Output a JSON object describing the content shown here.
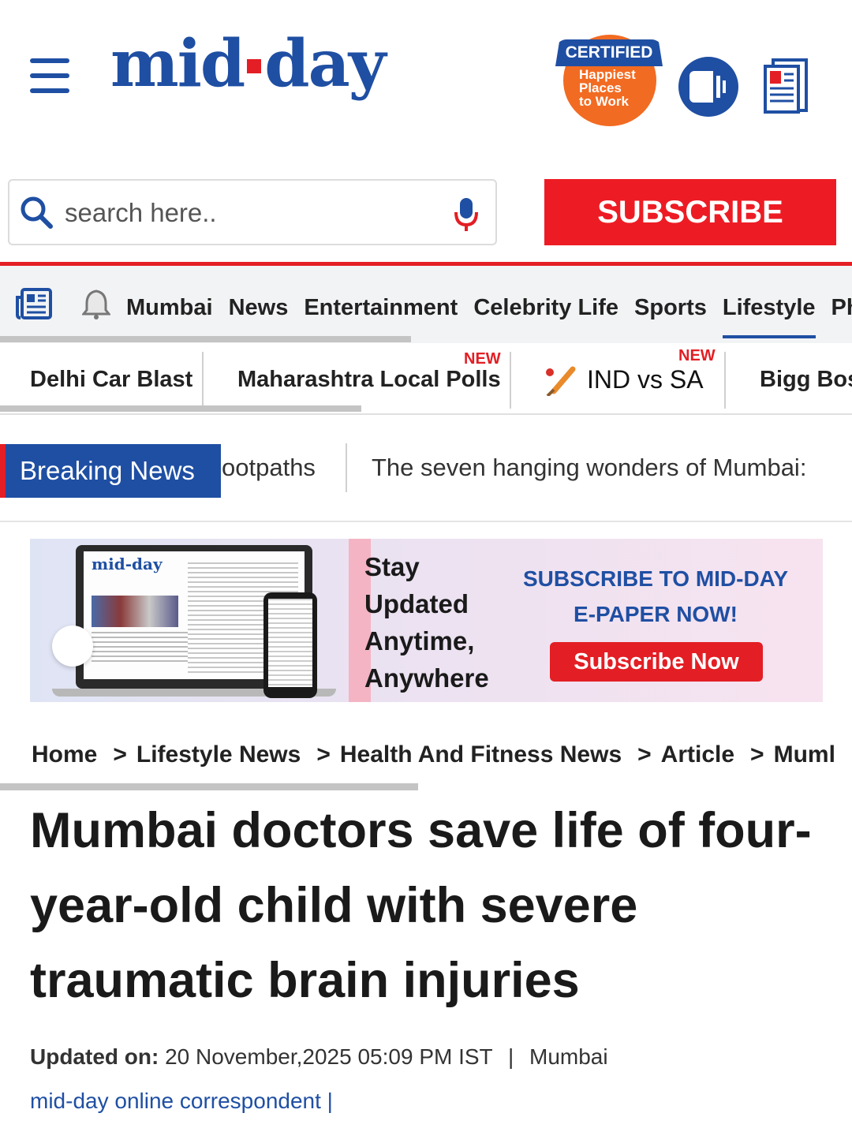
{
  "header": {
    "logo_text_left": "mid",
    "logo_text_right": "day",
    "badge": {
      "ribbon": "CERTIFIED",
      "line1": "Happiest",
      "line2": "Places",
      "line3": "to Work"
    },
    "icons": [
      "hamburger-icon",
      "audio-icon",
      "epaper-icon"
    ]
  },
  "search": {
    "placeholder": "search here..",
    "value": ""
  },
  "subscribe_label": "SUBSCRIBE",
  "main_nav": {
    "items": [
      {
        "label": "Mumbai"
      },
      {
        "label": "News"
      },
      {
        "label": "Entertainment"
      },
      {
        "label": "Celebrity Life"
      },
      {
        "label": "Sports"
      },
      {
        "label": "Lifestyle",
        "active": true
      },
      {
        "label": "Pho"
      }
    ]
  },
  "trending": {
    "items": [
      {
        "label": "Delhi Car Blast"
      },
      {
        "label": "Maharashtra Local Polls",
        "tag": "NEW"
      },
      {
        "label": "IND vs SA",
        "tag": "NEW"
      },
      {
        "label": "Bigg Bos"
      }
    ]
  },
  "breaking": {
    "label": "Breaking News",
    "ticker": [
      "ootpaths",
      "The seven hanging wonders of Mumbai:"
    ]
  },
  "banner": {
    "screen_logo": "mid-day",
    "tagline": [
      "Stay",
      "Updated",
      "Anytime,",
      "Anywhere"
    ],
    "cta_line1": "SUBSCRIBE TO MID-DAY",
    "cta_line2": "E-PAPER NOW!",
    "cta_button": "Subscribe Now"
  },
  "breadcrumb": [
    "Home",
    "Lifestyle News",
    "Health And Fitness News",
    "Article",
    "Muml"
  ],
  "article": {
    "headline": "Mumbai doctors save life of four-year-old child with severe traumatic brain injuries",
    "updated_label": "Updated on:",
    "updated_value": "20 November,2025 05:09 PM IST",
    "location": "Mumbai",
    "author": "mid-day online correspondent",
    "author_sep": "|"
  },
  "colors": {
    "brand_blue": "#1f4fa3",
    "brand_red": "#e31e24",
    "badge_orange": "#f26b22"
  }
}
